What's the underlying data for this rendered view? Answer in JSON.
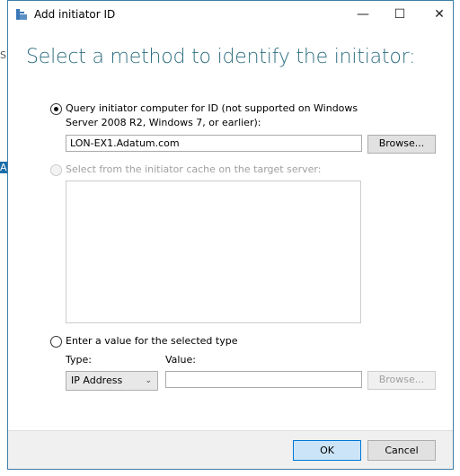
{
  "window": {
    "title": "Add initiator ID",
    "minimize": "—",
    "maximize": "☐",
    "close": "✕"
  },
  "heading": "Select a method to identify the initiator:",
  "option_query": {
    "label_line1": "Query initiator computer for ID (not supported on Windows",
    "label_line2": "Server 2008 R2, Windows 7, or earlier):",
    "value": "LON-EX1.Adatum.com",
    "browse": "Browse...",
    "selected": true
  },
  "option_cache": {
    "label": "Select from the initiator cache on the target server:",
    "enabled": false
  },
  "option_value": {
    "label": "Enter a value for the selected type",
    "type_label": "Type:",
    "type_value": "IP Address",
    "value_label": "Value:",
    "value": "",
    "browse": "Browse...",
    "selected": false
  },
  "buttons": {
    "ok": "OK",
    "cancel": "Cancel"
  },
  "colors": {
    "heading": "#2e6e80",
    "ok_bg": "#cce4f7",
    "border": "#3c7fa8"
  }
}
